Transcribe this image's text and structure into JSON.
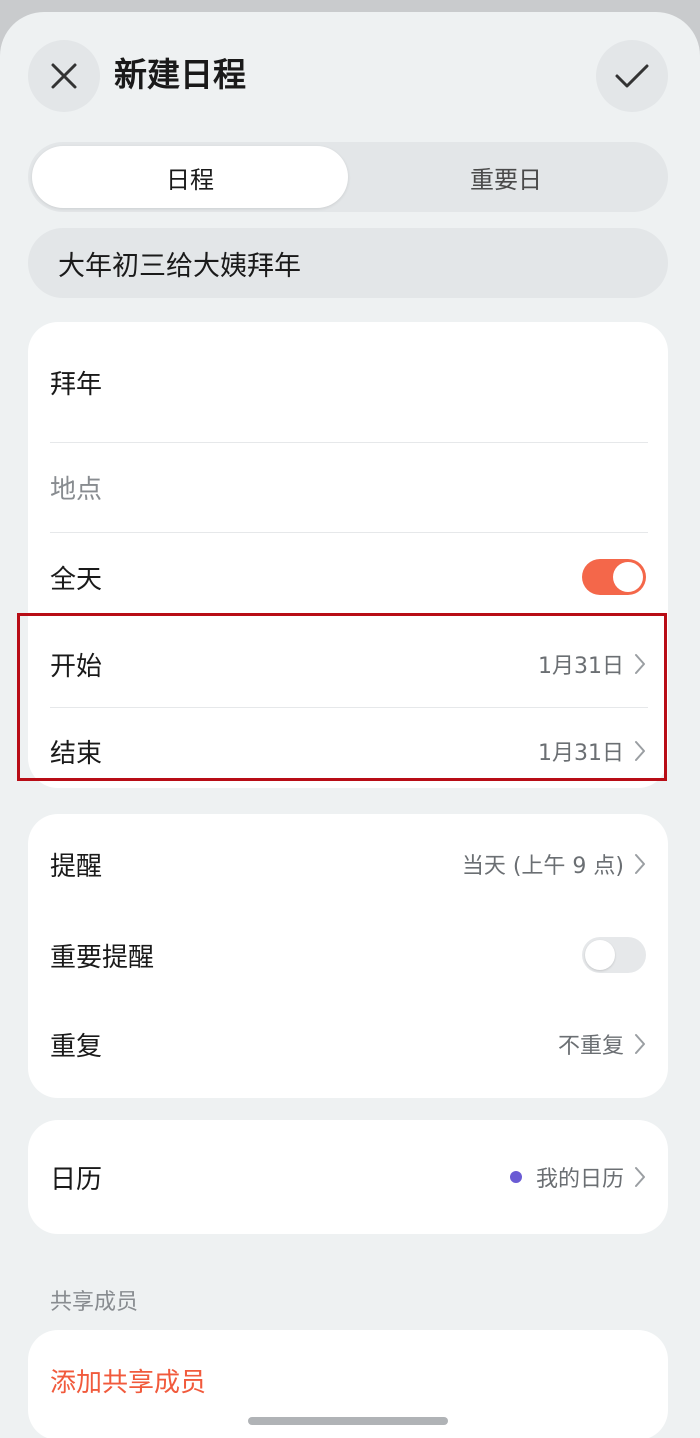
{
  "header": {
    "title": "新建日程",
    "close_icon": "close-icon",
    "confirm_icon": "check-icon"
  },
  "tabs": [
    {
      "label": "日程",
      "active": true
    },
    {
      "label": "重要日",
      "active": false
    }
  ],
  "event_title": {
    "value": "大年初三给大姨拜年"
  },
  "details": {
    "note": "拜年",
    "location_placeholder": "地点",
    "all_day": {
      "label": "全天",
      "on": true
    },
    "start": {
      "label": "开始",
      "value": "1月31日"
    },
    "end": {
      "label": "结束",
      "value": "1月31日"
    }
  },
  "reminders": {
    "reminder": {
      "label": "提醒",
      "value": "当天 (上午 9 点)"
    },
    "important": {
      "label": "重要提醒",
      "on": false
    },
    "repeat": {
      "label": "重复",
      "value": "不重复"
    }
  },
  "calendar": {
    "label": "日历",
    "value": "我的日历",
    "dot_color": "#6a5bd4"
  },
  "sharing": {
    "section_label": "共享成员",
    "add_label": "添加共享成员"
  },
  "colors": {
    "accent": "#f4674a",
    "highlight": "#b80d16"
  }
}
